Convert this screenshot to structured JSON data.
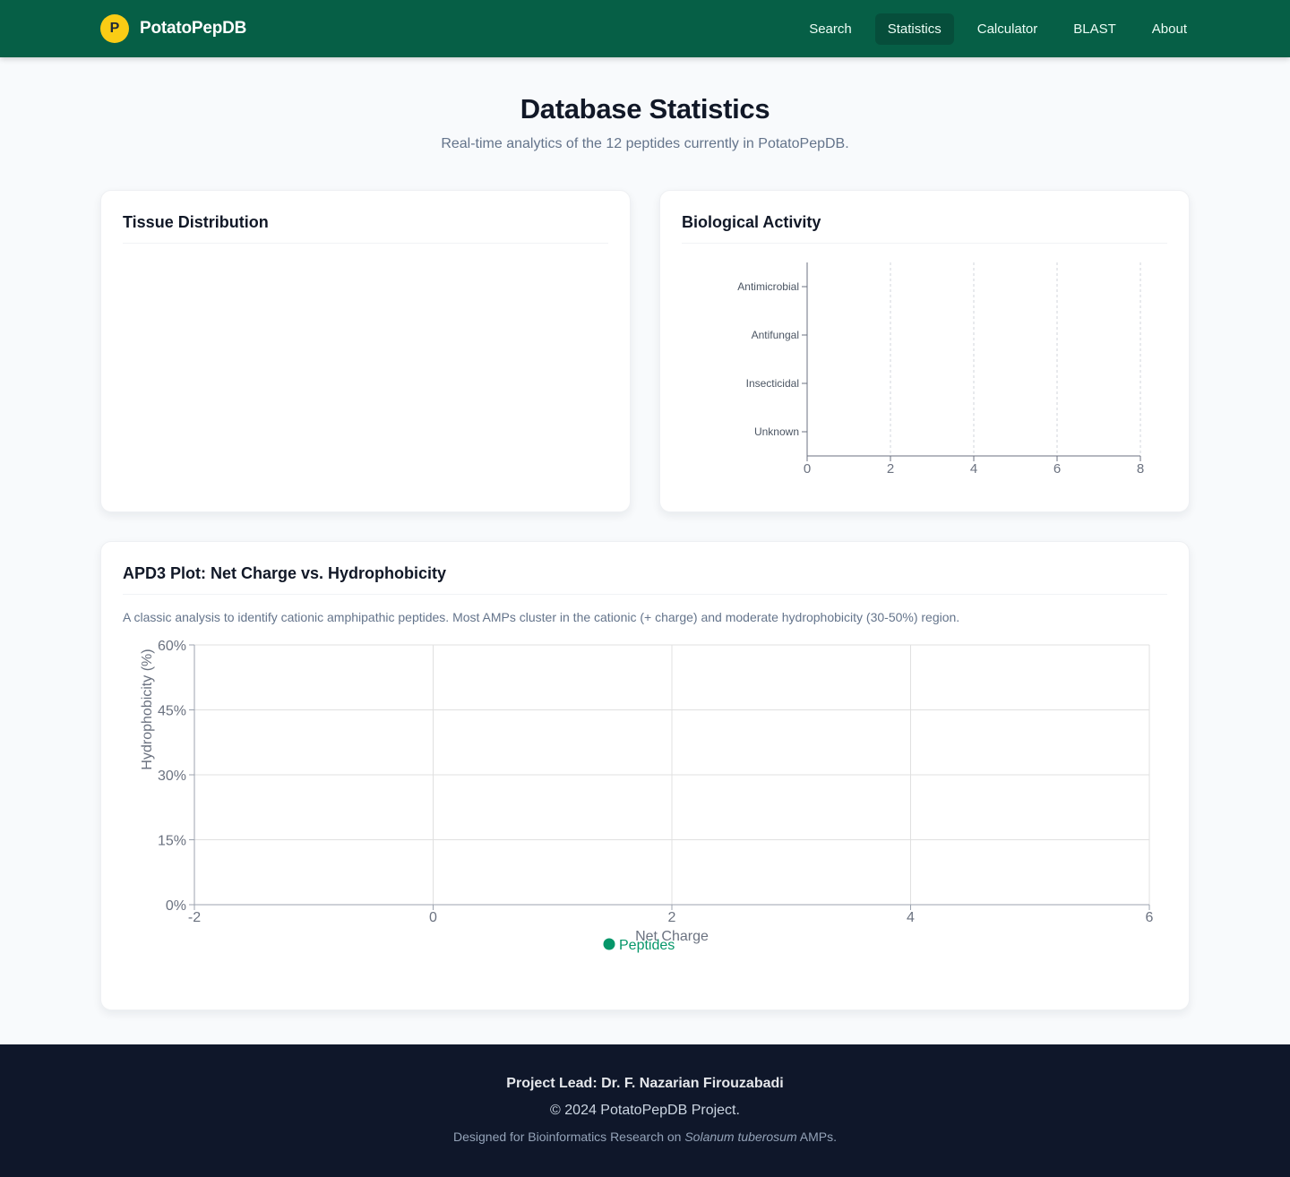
{
  "nav": {
    "logo_letter": "P",
    "brand": "PotatoPepDB",
    "links": [
      "Search",
      "Statistics",
      "Calculator",
      "BLAST",
      "About"
    ],
    "active": "Statistics"
  },
  "header": {
    "title": "Database Statistics",
    "subtitle": "Real-time analytics of the 12 peptides currently in PotatoPepDB."
  },
  "tissue_card": {
    "title": "Tissue Distribution"
  },
  "activity_card": {
    "title": "Biological Activity"
  },
  "apd_card": {
    "title": "APD3 Plot: Net Charge vs. Hydrophobicity",
    "description": "A classic analysis to identify cationic amphipathic peptides. Most AMPs cluster in the cationic (+ charge) and moderate hydrophobicity (30-50%) region."
  },
  "chart_data": [
    {
      "type": "bar",
      "orientation": "horizontal",
      "categories": [
        "Antimicrobial",
        "Antifungal",
        "Insecticidal",
        "Unknown"
      ],
      "values": [
        0,
        0,
        0,
        0
      ],
      "xlim": [
        0,
        8
      ],
      "xticks": [
        "0",
        "2",
        "4",
        "6",
        "8"
      ],
      "grid": "vertical-dashed"
    },
    {
      "type": "scatter",
      "series": [
        {
          "name": "Peptides",
          "points": [],
          "color": "#059669"
        }
      ],
      "xlabel": "Net Charge",
      "ylabel": "Hydrophobicity (%)",
      "xlim": [
        -2,
        6
      ],
      "ylim": [
        0,
        60
      ],
      "xticks": [
        "-2",
        "0",
        "2",
        "4",
        "6"
      ],
      "yticks": [
        "0%",
        "15%",
        "30%",
        "45%",
        "60%"
      ],
      "grid": true,
      "legend": "bottom"
    }
  ],
  "footer": {
    "lead": "Project Lead: Dr. F. Nazarian Firouzabadi",
    "copyright": "© 2024 PotatoPepDB Project.",
    "note_prefix": "Designed for Bioinformatics Research on ",
    "note_species": "Solanum tuberosum",
    "note_suffix": " AMPs."
  },
  "colors": {
    "nav_bg": "#065f46",
    "logo": "#facc15",
    "accent": "#059669",
    "footer_bg": "#0f172a"
  }
}
